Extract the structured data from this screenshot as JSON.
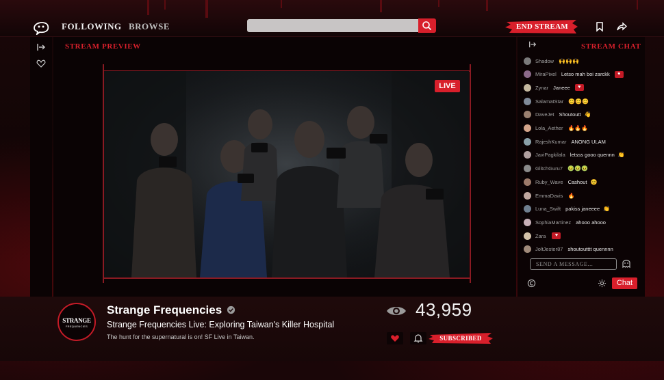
{
  "nav": {
    "following": "FOLLOWING",
    "browse": "BROWSE",
    "search_placeholder": "",
    "end_stream": "END STREAM"
  },
  "preview": {
    "label": "STREAM PREVIEW",
    "live": "LIVE"
  },
  "chat": {
    "title": "STREAM CHAT",
    "messages": [
      {
        "user": "Shadow",
        "text": "",
        "emoji": "🙌🙌🙌",
        "heart": false
      },
      {
        "user": "MiraPixel",
        "text": "Letso mah boi zarckk",
        "emoji": "",
        "heart": true
      },
      {
        "user": "Zynar",
        "text": "Janeee",
        "emoji": "",
        "heart": true
      },
      {
        "user": "SalamatStar",
        "text": "",
        "emoji": "😊😊😊",
        "heart": false
      },
      {
        "user": "DaveJet",
        "text": "Shoutoutt",
        "emoji": "👋",
        "heart": false
      },
      {
        "user": "Lola_Aether",
        "text": "",
        "emoji": "🔥🔥🔥",
        "heart": false
      },
      {
        "user": "RajeshKumar",
        "text": "ANONG ULAM",
        "emoji": "",
        "heart": false
      },
      {
        "user": "JaviPagkilala",
        "text": "letsss gooo quennn",
        "emoji": "👏",
        "heart": false
      },
      {
        "user": "GlitchGuru7",
        "text": "",
        "emoji": "🤢🤢🤢",
        "heart": false
      },
      {
        "user": "Ruby_Wave",
        "text": "Cashout",
        "emoji": "😊",
        "heart": false
      },
      {
        "user": "EmmaDavis",
        "text": "",
        "emoji": "🔥",
        "heart": false
      },
      {
        "user": "Luna_Swift",
        "text": "pakiss janeeee",
        "emoji": "👏",
        "heart": false
      },
      {
        "user": "SophiaMartinez",
        "text": "ahooo ahooo",
        "emoji": "",
        "heart": false
      },
      {
        "user": "Zara",
        "text": "",
        "emoji": "",
        "heart": true
      },
      {
        "user": "JoltJester87",
        "text": "shoutoutttt quennnn",
        "emoji": "",
        "heart": false
      }
    ],
    "input_placeholder": "SEND A MESSAGE...",
    "chat_button": "Chat"
  },
  "channel": {
    "avatar_text": "STRANGE",
    "avatar_sub": "FREQUENCIES",
    "name": "Strange Frequencies",
    "stream_title": "Strange Frequencies Live: Exploring Taiwan's Killer Hospital",
    "description": "The hunt for the supernatural is on! SF Live in Taiwan.",
    "viewers": "43,959",
    "subscribed": "SUBSCRIBED"
  },
  "colors": {
    "accent": "#d81f2b",
    "background": "#0d0506"
  }
}
